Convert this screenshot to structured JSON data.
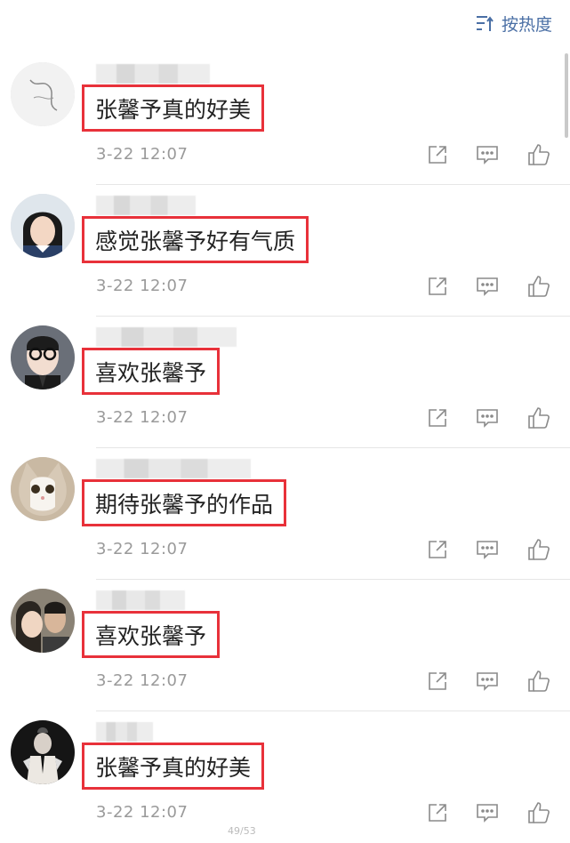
{
  "header": {
    "sort_label": "按热度"
  },
  "comments": [
    {
      "text": "张馨予真的好美",
      "time": "3-22 12:07"
    },
    {
      "text": "感觉张馨予好有气质",
      "time": "3-22 12:07"
    },
    {
      "text": "喜欢张馨予",
      "time": "3-22 12:07"
    },
    {
      "text": "期待张馨予的作品",
      "time": "3-22 12:07"
    },
    {
      "text": "喜欢张馨予",
      "time": "3-22 12:07"
    },
    {
      "text": "张馨予真的好美",
      "time": "3-22 12:07"
    }
  ],
  "footer": {
    "page_indicator": "49/53"
  },
  "colors": {
    "accent": "#4a6fa5",
    "highlight_border": "#e8313a",
    "meta_text": "#9a9a9a"
  }
}
